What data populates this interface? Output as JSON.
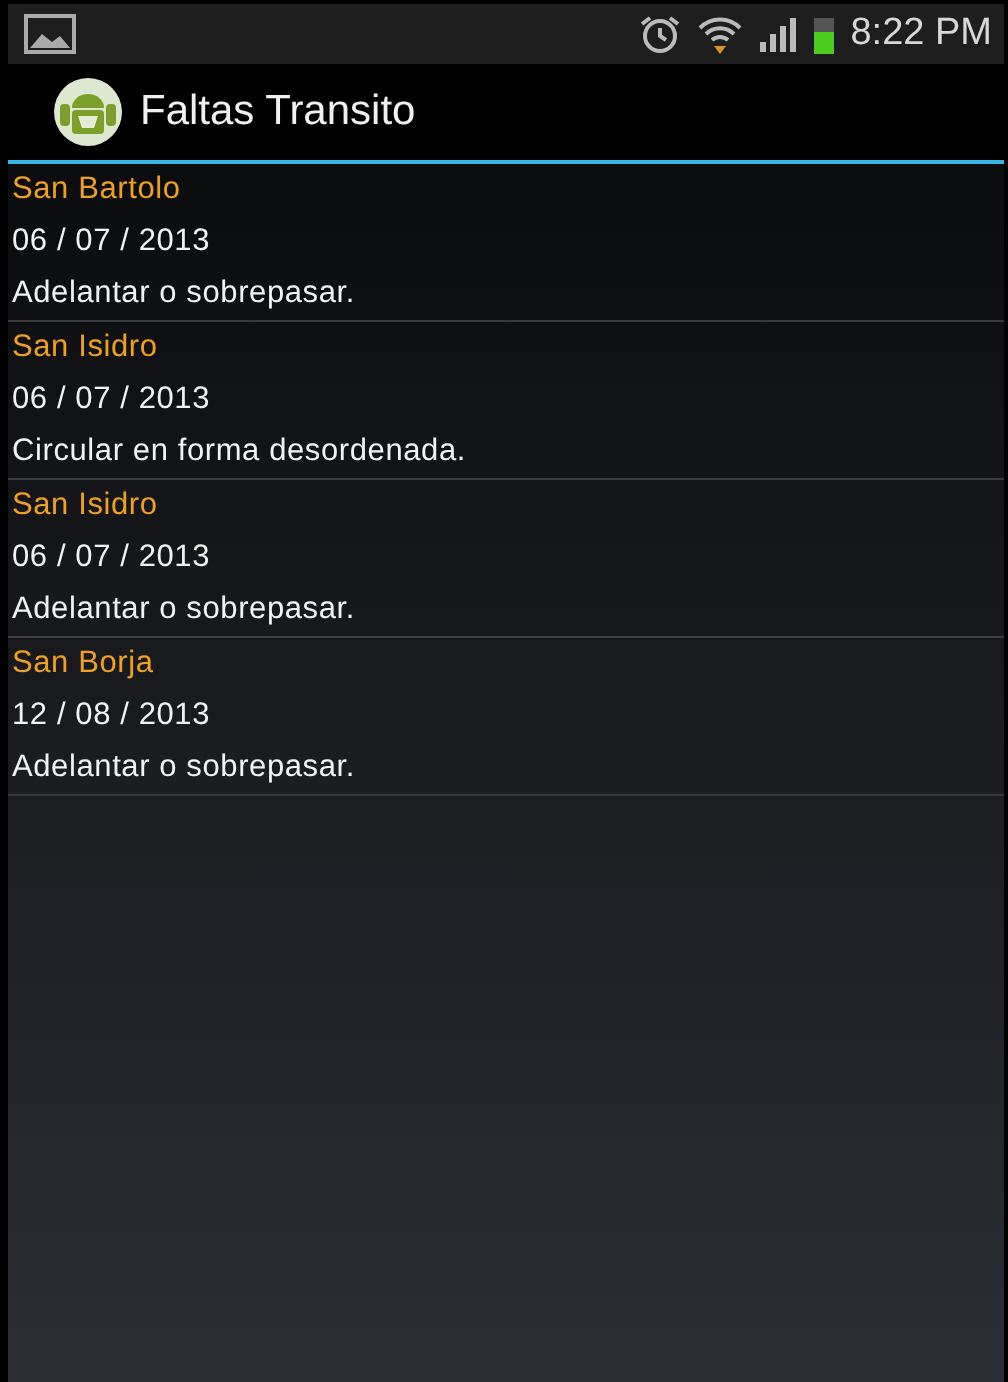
{
  "status_bar": {
    "time": "8:22 PM"
  },
  "action_bar": {
    "title": "Faltas Transito"
  },
  "items": [
    {
      "place": "San Bartolo",
      "date": "06 / 07 / 2013",
      "offense": "Adelantar o sobrepasar."
    },
    {
      "place": "San Isidro",
      "date": "06 / 07 / 2013",
      "offense": "Circular en forma desordenada."
    },
    {
      "place": "San Isidro",
      "date": "06 / 07 / 2013",
      "offense": "Adelantar o sobrepasar."
    },
    {
      "place": "San Borja",
      "date": "12 / 08 / 2013",
      "offense": "Adelantar o sobrepasar."
    }
  ]
}
